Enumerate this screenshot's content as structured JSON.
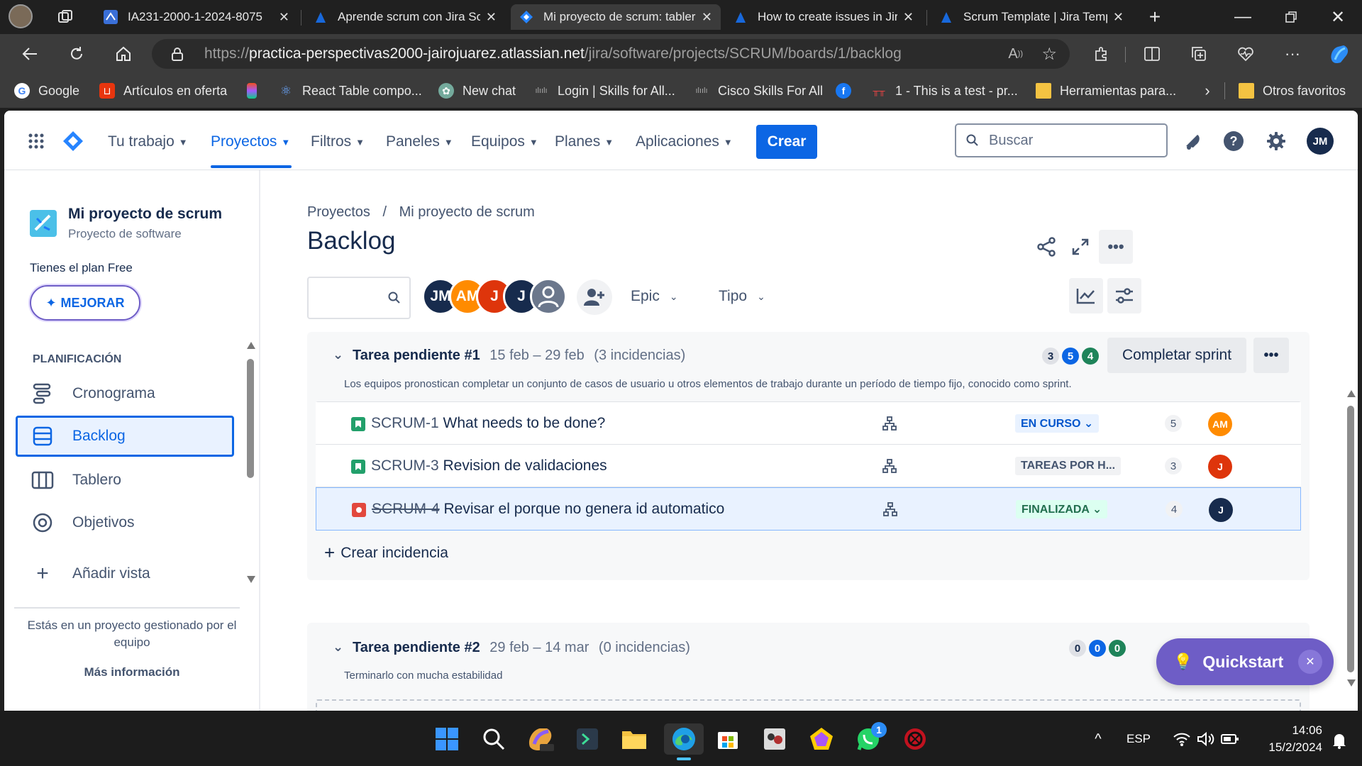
{
  "browser": {
    "tabs": [
      {
        "title": "IA231-2000-1-2024-8075"
      },
      {
        "title": "Aprende scrum con Jira Software"
      },
      {
        "title": "Mi proyecto de scrum: tablero"
      },
      {
        "title": "How to create issues in Jira"
      },
      {
        "title": "Scrum Template | Jira Template"
      }
    ],
    "url_prefix": "https://",
    "url_host": "practica-perspectivas2000-jairojuarez.atlassian.net",
    "url_path": "/jira/software/projects/SCRUM/boards/1/backlog",
    "bookmarks": [
      {
        "label": "Google"
      },
      {
        "label": "Artículos en oferta"
      },
      {
        "label": ""
      },
      {
        "label": "React Table compo..."
      },
      {
        "label": "New chat"
      },
      {
        "label": "Login | Skills for All..."
      },
      {
        "label": "Cisco Skills For All"
      },
      {
        "label": ""
      },
      {
        "label": "1 - This is a test - pr..."
      },
      {
        "label": "Herramientas para..."
      }
    ],
    "other_favorites": "Otros favoritos"
  },
  "jira_nav": {
    "items": [
      {
        "label": "Tu trabajo"
      },
      {
        "label": "Proyectos"
      },
      {
        "label": "Filtros"
      },
      {
        "label": "Paneles"
      },
      {
        "label": "Equipos"
      },
      {
        "label": "Planes"
      },
      {
        "label": "Aplicaciones"
      }
    ],
    "create_label": "Crear",
    "search_placeholder": "Buscar",
    "user_initials": "JM"
  },
  "sidebar": {
    "project_name": "Mi proyecto de scrum",
    "project_type": "Proyecto de software",
    "plan_text": "Tienes el plan Free",
    "upgrade_label": "MEJORAR",
    "section_label": "PLANIFICACIÓN",
    "items": [
      {
        "label": "Cronograma"
      },
      {
        "label": "Backlog"
      },
      {
        "label": "Tablero"
      },
      {
        "label": "Objetivos"
      },
      {
        "label": "Añadir vista"
      }
    ],
    "footer_text": "Estás en un proyecto gestionado por el equipo",
    "more_info": "Más información"
  },
  "main": {
    "breadcrumb": {
      "root": "Proyectos",
      "sep": "/",
      "project": "Mi proyecto de scrum"
    },
    "title": "Backlog",
    "avatars": [
      {
        "initials": "JM",
        "color": "#172b4d"
      },
      {
        "initials": "AM",
        "color": "#ff8b00"
      },
      {
        "initials": "J",
        "color": "#de350b"
      },
      {
        "initials": "J",
        "color": "#172b4d"
      }
    ],
    "filter_epic": "Epic",
    "filter_type": "Tipo",
    "sprints": [
      {
        "name": "Tarea pendiente #1",
        "dates": "15 feb – 29 feb",
        "count": "(3 incidencias)",
        "goal": "Los equipos pronostican completar un conjunto de casos de usuario u otros elementos de trabajo durante un período de tiempo fijo, conocido como sprint.",
        "pill_todo": "3",
        "pill_progress": "5",
        "pill_done": "4",
        "action": "Completar sprint",
        "issues": [
          {
            "key": "SCRUM-1",
            "summary": "What needs to be done?",
            "status": "EN CURSO ⌄",
            "points": "5",
            "assignee": "AM",
            "assignee_color": "#ff8b00",
            "type": "story"
          },
          {
            "key": "SCRUM-3",
            "summary": "Revision de validaciones",
            "status": "TAREAS POR H...",
            "points": "3",
            "assignee": "J",
            "assignee_color": "#de350b",
            "type": "story"
          },
          {
            "key": "SCRUM-4",
            "summary": "Revisar el porque no genera id automatico",
            "status": "FINALIZADA ⌄",
            "points": "4",
            "assignee": "J",
            "assignee_color": "#172b4d",
            "type": "bug"
          }
        ],
        "create_issue": "Crear incidencia"
      },
      {
        "name": "Tarea pendiente #2",
        "dates": "29 feb – 14 mar",
        "count": "(0 incidencias)",
        "goal": "Terminarlo con mucha estabilidad",
        "pill_todo": "0",
        "pill_progress": "0",
        "pill_done": "0"
      }
    ],
    "quickstart": "Quickstart"
  },
  "taskbar": {
    "lang": "ESP",
    "time": "14:06",
    "date": "15/2/2024",
    "whatsapp_badge": "1"
  }
}
